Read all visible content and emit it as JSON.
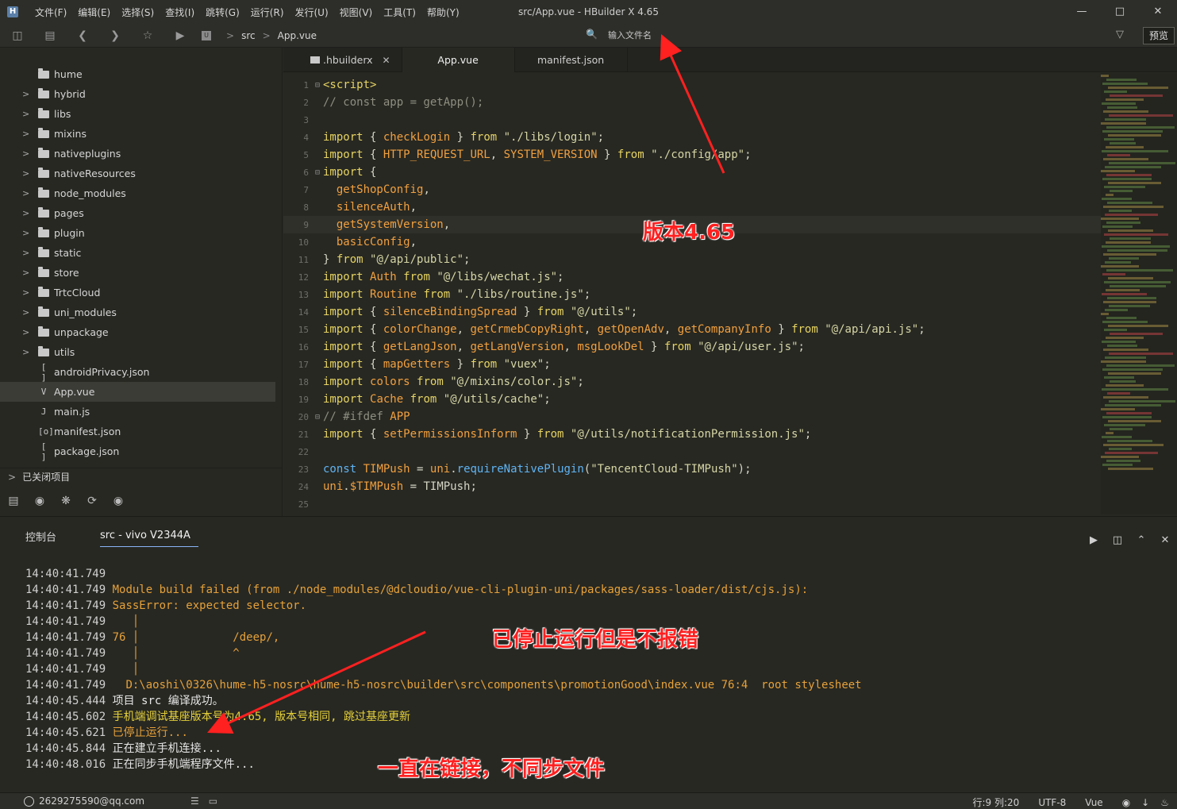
{
  "window": {
    "title": "src/App.vue - HBuilder X 4.65",
    "menu": [
      "文件(F)",
      "编辑(E)",
      "选择(S)",
      "查找(I)",
      "跳转(G)",
      "运行(R)",
      "发行(U)",
      "视图(V)",
      "工具(T)",
      "帮助(Y)"
    ]
  },
  "toolbar": {
    "breadcrumb": [
      "src",
      "App.vue"
    ],
    "file_search_placeholder": "输入文件名",
    "preview_label": "预览"
  },
  "sidebar": {
    "items": [
      {
        "label": "hume",
        "type": "folder",
        "expandable": false
      },
      {
        "label": "hybrid",
        "type": "folder",
        "expandable": true
      },
      {
        "label": "libs",
        "type": "folder",
        "expandable": true
      },
      {
        "label": "mixins",
        "type": "folder",
        "expandable": true
      },
      {
        "label": "nativeplugins",
        "type": "folder",
        "expandable": true
      },
      {
        "label": "nativeResources",
        "type": "folder",
        "expandable": true
      },
      {
        "label": "node_modules",
        "type": "folder",
        "expandable": true
      },
      {
        "label": "pages",
        "type": "folder",
        "expandable": true
      },
      {
        "label": "plugin",
        "type": "folder",
        "expandable": true
      },
      {
        "label": "static",
        "type": "folder",
        "expandable": true
      },
      {
        "label": "store",
        "type": "folder",
        "expandable": true
      },
      {
        "label": "TrtcCloud",
        "type": "folder",
        "expandable": true
      },
      {
        "label": "uni_modules",
        "type": "folder",
        "expandable": true
      },
      {
        "label": "unpackage",
        "type": "folder",
        "expandable": true
      },
      {
        "label": "utils",
        "type": "folder",
        "expandable": true
      },
      {
        "label": "androidPrivacy.json",
        "type": "json",
        "expandable": false
      },
      {
        "label": "App.vue",
        "type": "vue",
        "expandable": false,
        "selected": true
      },
      {
        "label": "main.js",
        "type": "js",
        "expandable": false
      },
      {
        "label": "manifest.json",
        "type": "manifest",
        "expandable": false
      },
      {
        "label": "package.json",
        "type": "json",
        "expandable": false
      }
    ],
    "closed_projects_label": "已关闭项目"
  },
  "tabs": [
    {
      "label": ".hbuilderx",
      "active": false,
      "closable": true
    },
    {
      "label": "App.vue",
      "active": true,
      "closable": false
    },
    {
      "label": "manifest.json",
      "active": false,
      "closable": false
    }
  ],
  "editor": {
    "current_line": 9,
    "lines": [
      {
        "n": "1",
        "fold": true,
        "tokens": [
          [
            "c-tag",
            "<script>"
          ]
        ]
      },
      {
        "n": "2",
        "tokens": [
          [
            "c-cm",
            "// const app = getApp();"
          ]
        ]
      },
      {
        "n": "3",
        "tokens": []
      },
      {
        "n": "4",
        "tokens": [
          [
            "c-kw",
            "import"
          ],
          [
            "c-pl",
            " { "
          ],
          [
            "c-id",
            "checkLogin"
          ],
          [
            "c-pl",
            " } "
          ],
          [
            "c-kw",
            "from"
          ],
          [
            "c-pl",
            " "
          ],
          [
            "c-str",
            "\"./libs/login\""
          ],
          [
            "c-pl",
            ";"
          ]
        ]
      },
      {
        "n": "5",
        "tokens": [
          [
            "c-kw",
            "import"
          ],
          [
            "c-pl",
            " { "
          ],
          [
            "c-id",
            "HTTP_REQUEST_URL"
          ],
          [
            "c-pl",
            ", "
          ],
          [
            "c-id",
            "SYSTEM_VERSION"
          ],
          [
            "c-pl",
            " } "
          ],
          [
            "c-kw",
            "from"
          ],
          [
            "c-pl",
            " "
          ],
          [
            "c-str",
            "\"./config/app\""
          ],
          [
            "c-pl",
            ";"
          ]
        ]
      },
      {
        "n": "6",
        "fold": true,
        "tokens": [
          [
            "c-kw",
            "import"
          ],
          [
            "c-pl",
            " {"
          ]
        ]
      },
      {
        "n": "7",
        "tokens": [
          [
            "c-pl",
            "  "
          ],
          [
            "c-id",
            "getShopConfig"
          ],
          [
            "c-pl",
            ","
          ]
        ]
      },
      {
        "n": "8",
        "tokens": [
          [
            "c-pl",
            "  "
          ],
          [
            "c-id",
            "silenceAuth"
          ],
          [
            "c-pl",
            ","
          ]
        ]
      },
      {
        "n": "9",
        "tokens": [
          [
            "c-pl",
            "  "
          ],
          [
            "c-id",
            "getSystemVersion"
          ],
          [
            "c-pl",
            ","
          ]
        ]
      },
      {
        "n": "10",
        "tokens": [
          [
            "c-pl",
            "  "
          ],
          [
            "c-id",
            "basicConfig"
          ],
          [
            "c-pl",
            ","
          ]
        ]
      },
      {
        "n": "11",
        "tokens": [
          [
            "c-pl",
            "} "
          ],
          [
            "c-kw",
            "from"
          ],
          [
            "c-pl",
            " "
          ],
          [
            "c-str",
            "\"@/api/public\""
          ],
          [
            "c-pl",
            ";"
          ]
        ]
      },
      {
        "n": "12",
        "tokens": [
          [
            "c-kw",
            "import"
          ],
          [
            "c-pl",
            " "
          ],
          [
            "c-id",
            "Auth"
          ],
          [
            "c-pl",
            " "
          ],
          [
            "c-kw",
            "from"
          ],
          [
            "c-pl",
            " "
          ],
          [
            "c-str",
            "\"@/libs/wechat.js\""
          ],
          [
            "c-pl",
            ";"
          ]
        ]
      },
      {
        "n": "13",
        "tokens": [
          [
            "c-kw",
            "import"
          ],
          [
            "c-pl",
            " "
          ],
          [
            "c-id",
            "Routine"
          ],
          [
            "c-pl",
            " "
          ],
          [
            "c-kw",
            "from"
          ],
          [
            "c-pl",
            " "
          ],
          [
            "c-str",
            "\"./libs/routine.js\""
          ],
          [
            "c-pl",
            ";"
          ]
        ]
      },
      {
        "n": "14",
        "tokens": [
          [
            "c-kw",
            "import"
          ],
          [
            "c-pl",
            " { "
          ],
          [
            "c-id",
            "silenceBindingSpread"
          ],
          [
            "c-pl",
            " } "
          ],
          [
            "c-kw",
            "from"
          ],
          [
            "c-pl",
            " "
          ],
          [
            "c-str",
            "\"@/utils\""
          ],
          [
            "c-pl",
            ";"
          ]
        ]
      },
      {
        "n": "15",
        "tokens": [
          [
            "c-kw",
            "import"
          ],
          [
            "c-pl",
            " { "
          ],
          [
            "c-id",
            "colorChange"
          ],
          [
            "c-pl",
            ", "
          ],
          [
            "c-id",
            "getCrmebCopyRight"
          ],
          [
            "c-pl",
            ", "
          ],
          [
            "c-id",
            "getOpenAdv"
          ],
          [
            "c-pl",
            ", "
          ],
          [
            "c-id",
            "getCompanyInfo"
          ],
          [
            "c-pl",
            " } "
          ],
          [
            "c-kw",
            "from"
          ],
          [
            "c-pl",
            " "
          ],
          [
            "c-str",
            "\"@/api/api.js\""
          ],
          [
            "c-pl",
            ";"
          ]
        ]
      },
      {
        "n": "16",
        "tokens": [
          [
            "c-kw",
            "import"
          ],
          [
            "c-pl",
            " { "
          ],
          [
            "c-id",
            "getLangJson"
          ],
          [
            "c-pl",
            ", "
          ],
          [
            "c-id",
            "getLangVersion"
          ],
          [
            "c-pl",
            ", "
          ],
          [
            "c-id",
            "msgLookDel"
          ],
          [
            "c-pl",
            " } "
          ],
          [
            "c-kw",
            "from"
          ],
          [
            "c-pl",
            " "
          ],
          [
            "c-str",
            "\"@/api/user.js\""
          ],
          [
            "c-pl",
            ";"
          ]
        ]
      },
      {
        "n": "17",
        "tokens": [
          [
            "c-kw",
            "import"
          ],
          [
            "c-pl",
            " { "
          ],
          [
            "c-id",
            "mapGetters"
          ],
          [
            "c-pl",
            " } "
          ],
          [
            "c-kw",
            "from"
          ],
          [
            "c-pl",
            " "
          ],
          [
            "c-str",
            "\"vuex\""
          ],
          [
            "c-pl",
            ";"
          ]
        ]
      },
      {
        "n": "18",
        "tokens": [
          [
            "c-kw",
            "import"
          ],
          [
            "c-pl",
            " "
          ],
          [
            "c-id",
            "colors"
          ],
          [
            "c-pl",
            " "
          ],
          [
            "c-kw",
            "from"
          ],
          [
            "c-pl",
            " "
          ],
          [
            "c-str",
            "\"@/mixins/color.js\""
          ],
          [
            "c-pl",
            ";"
          ]
        ]
      },
      {
        "n": "19",
        "tokens": [
          [
            "c-kw",
            "import"
          ],
          [
            "c-pl",
            " "
          ],
          [
            "c-id",
            "Cache"
          ],
          [
            "c-pl",
            " "
          ],
          [
            "c-kw",
            "from"
          ],
          [
            "c-pl",
            " "
          ],
          [
            "c-str",
            "\"@/utils/cache\""
          ],
          [
            "c-pl",
            ";"
          ]
        ]
      },
      {
        "n": "20",
        "fold": true,
        "tokens": [
          [
            "c-cm",
            "// #ifdef "
          ],
          [
            "c-pp",
            "APP"
          ]
        ]
      },
      {
        "n": "21",
        "tokens": [
          [
            "c-kw",
            "import"
          ],
          [
            "c-pl",
            " { "
          ],
          [
            "c-id",
            "setPermissionsInform"
          ],
          [
            "c-pl",
            " } "
          ],
          [
            "c-kw",
            "from"
          ],
          [
            "c-pl",
            " "
          ],
          [
            "c-str",
            "\"@/utils/notificationPermission.js\""
          ],
          [
            "c-pl",
            ";"
          ]
        ]
      },
      {
        "n": "22",
        "tokens": []
      },
      {
        "n": "23",
        "tokens": [
          [
            "c-kw2",
            "const"
          ],
          [
            "c-pl",
            " "
          ],
          [
            "c-id",
            "TIMPush"
          ],
          [
            "c-pl",
            " = "
          ],
          [
            "c-id",
            "uni"
          ],
          [
            "c-pl",
            "."
          ],
          [
            "c-fn",
            "requireNativePlugin"
          ],
          [
            "c-pl",
            "("
          ],
          [
            "c-str",
            "\"TencentCloud-TIMPush\""
          ],
          [
            "c-pl",
            ");"
          ]
        ]
      },
      {
        "n": "24",
        "tokens": [
          [
            "c-id",
            "uni"
          ],
          [
            "c-pl",
            "."
          ],
          [
            "c-id",
            "$TIMPush"
          ],
          [
            "c-pl",
            " = TIMPush;"
          ]
        ]
      },
      {
        "n": "25",
        "tokens": []
      }
    ]
  },
  "console": {
    "tabs": [
      "控制台",
      "src - vivo V2344A"
    ],
    "active_tab": 1,
    "log": [
      {
        "ts": "14:40:41.749",
        "text": "",
        "cls": "log-err"
      },
      {
        "ts": "14:40:41.749",
        "text": "Module build failed (from ./node_modules/@dcloudio/vue-cli-plugin-uni/packages/sass-loader/dist/cjs.js):",
        "cls": "log-err"
      },
      {
        "ts": "14:40:41.749",
        "text": "SassError: expected selector.",
        "cls": "log-err"
      },
      {
        "ts": "14:40:41.749",
        "text": "   │",
        "cls": "log-err"
      },
      {
        "ts": "14:40:41.749",
        "text": "76 │              /deep/,",
        "cls": "log-err"
      },
      {
        "ts": "14:40:41.749",
        "text": "   │              ^",
        "cls": "log-err"
      },
      {
        "ts": "14:40:41.749",
        "text": "   │",
        "cls": "log-err"
      },
      {
        "ts": "14:40:41.749",
        "text": "  D:\\aoshi\\0326\\hume-h5-nosrc\\hume-h5-nosrc\\builder\\src\\components\\promotionGood\\index.vue 76:4  root stylesheet",
        "cls": "log-err"
      },
      {
        "ts": "14:40:45.444",
        "text": "项目 src 编译成功。",
        "cls": "log-ok"
      },
      {
        "ts": "14:40:45.602",
        "text": "手机端调试基座版本号为4.65, 版本号相同, 跳过基座更新",
        "cls": "log-warn"
      },
      {
        "ts": "14:40:45.621",
        "text": "已停止运行...",
        "cls": "log-err"
      },
      {
        "ts": "14:40:45.844",
        "text": "正在建立手机连接...",
        "cls": "log-ok"
      },
      {
        "ts": "14:40:48.016",
        "text": "正在同步手机端程序文件...",
        "cls": "log-ok"
      }
    ]
  },
  "annotations": {
    "version": "版本4.65",
    "stopped": "已停止运行但是不报错",
    "linking": "一直在链接，不同步文件"
  },
  "statusbar": {
    "user": "2629275590@qq.com",
    "position": "行:9  列:20",
    "encoding": "UTF-8",
    "language": "Vue"
  },
  "colors": {
    "accent": "#e6d363",
    "annotation": "#ff2020",
    "arrow": "#ff2020"
  }
}
